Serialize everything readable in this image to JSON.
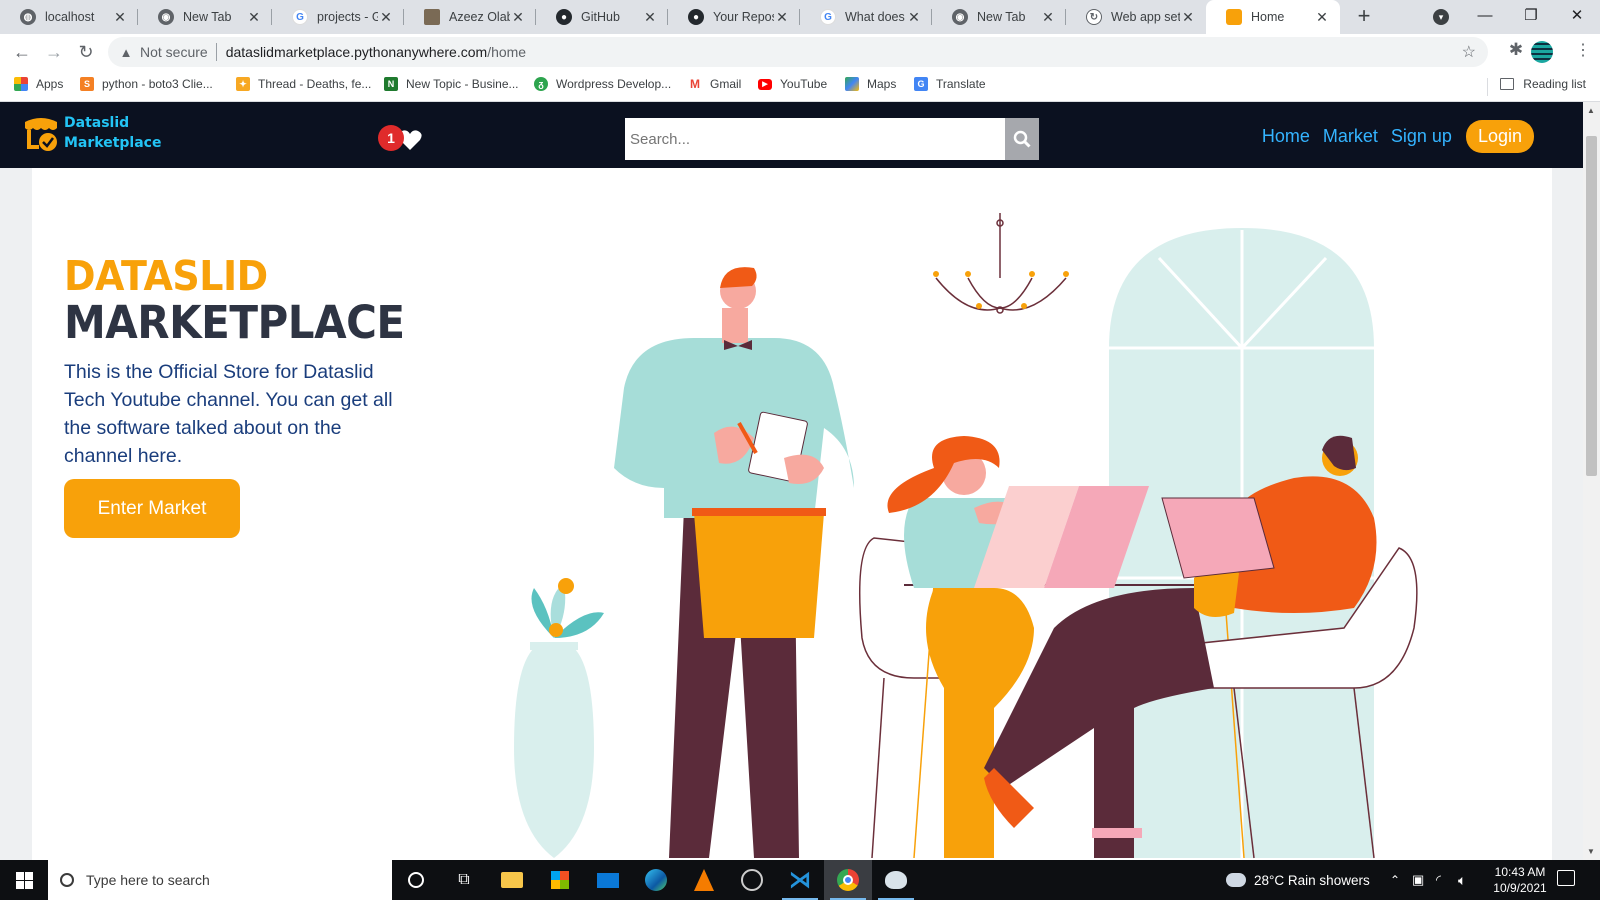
{
  "browser": {
    "tabs": [
      {
        "title": "localhost",
        "icon": "globe-icon"
      },
      {
        "title": "New Tab",
        "icon": "chrome-icon"
      },
      {
        "title": "projects - Go",
        "icon": "google-icon"
      },
      {
        "title": "Azeez Olabo",
        "icon": "avatar-icon"
      },
      {
        "title": "GitHub",
        "icon": "github-icon"
      },
      {
        "title": "Your Reposit",
        "icon": "github-icon"
      },
      {
        "title": "What does n",
        "icon": "google-icon"
      },
      {
        "title": "New Tab",
        "icon": "chrome-icon"
      },
      {
        "title": "Web app set",
        "icon": "loading-icon"
      },
      {
        "title": "Home",
        "icon": "site-favicon",
        "active": true
      }
    ],
    "address": {
      "security_label": "Not secure",
      "host": "dataslidmarketplace.pythonanywhere.com",
      "path": "/home"
    },
    "bookmarks": [
      {
        "label": "Apps",
        "icon": "apps-grid-icon"
      },
      {
        "label": "python - boto3 Clie...",
        "icon": "stackoverflow-icon"
      },
      {
        "label": "Thread - Deaths, fe...",
        "icon": "forum-icon"
      },
      {
        "label": "New Topic - Busine...",
        "icon": "nairaland-icon"
      },
      {
        "label": "Wordpress Develop...",
        "icon": "wordpress-icon"
      },
      {
        "label": "Gmail",
        "icon": "gmail-icon"
      },
      {
        "label": "YouTube",
        "icon": "youtube-icon"
      },
      {
        "label": "Maps",
        "icon": "maps-icon"
      },
      {
        "label": "Translate",
        "icon": "translate-icon"
      }
    ],
    "reading_list": "Reading list"
  },
  "site": {
    "logo_line1": "Dataslid",
    "logo_line2": "Marketplace",
    "notification_count": "1",
    "search_placeholder": "Search...",
    "nav": {
      "home": "Home",
      "market": "Market",
      "signup": "Sign up",
      "login": "Login"
    },
    "hero": {
      "title_line1": "DATASLID",
      "title_line2": "MARKETPLACE",
      "description": "This is the Official Store for Dataslid Tech Youtube channel. You can get all the software talked about on the channel here.",
      "cta": "Enter Market"
    },
    "colors": {
      "accent": "#f8a10a",
      "nav_bg": "#0b1120",
      "link": "#34b4ff",
      "text_blue": "#1a3d7c"
    }
  },
  "taskbar": {
    "search_placeholder": "Type here to search",
    "weather": "28°C  Rain showers",
    "time": "10:43 AM",
    "date": "10/9/2021"
  }
}
